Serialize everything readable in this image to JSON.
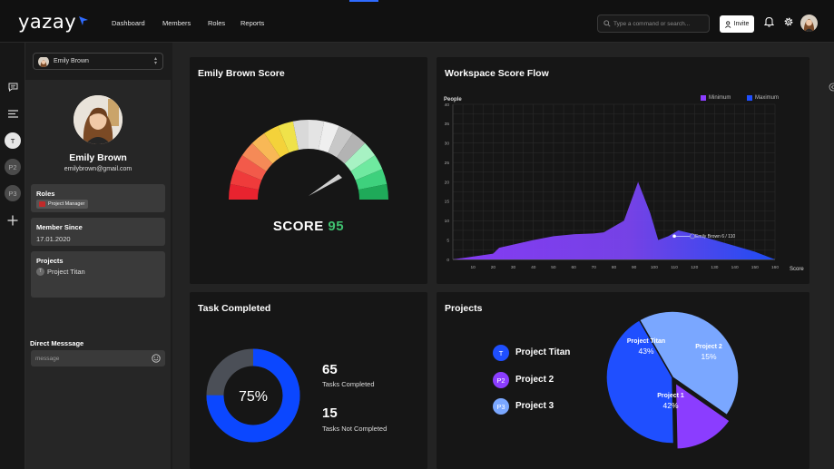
{
  "header": {
    "logo": "yazay",
    "nav": [
      "Dashboard",
      "Members",
      "Roles",
      "Reports"
    ],
    "search_placeholder": "Type a command or search...",
    "invite_label": "Invite"
  },
  "rail": {
    "items": [
      {
        "icon": "chat-icon"
      },
      {
        "icon": "list-icon"
      },
      {
        "label": "T"
      },
      {
        "label": "P2"
      },
      {
        "label": "P3"
      },
      {
        "icon": "plus-icon"
      }
    ]
  },
  "profile": {
    "selected_user": "Emily Brown",
    "name": "Emily Brown",
    "email": "emilybrown@gmail.com",
    "roles_label": "Roles",
    "role": "Project Manager",
    "member_since_label": "Member Since",
    "member_since": "17.01.2020",
    "projects_label": "Projects",
    "project": "Project Titan",
    "project_initial": "T",
    "dm_label": "Direct Messsage",
    "dm_placeholder": "message"
  },
  "score_card": {
    "title": "Emily Brown Score",
    "score_label": "SCORE",
    "score": "95"
  },
  "flow_card": {
    "title": "Workspace Score Flow",
    "y_title": "People",
    "x_title": "Score",
    "legend": [
      {
        "label": "Minimum",
        "color": "#8b3dff"
      },
      {
        "label": "Maximum",
        "color": "#1f4fff"
      }
    ],
    "tooltip": "Emily Brown 6 / 110"
  },
  "chart_data": {
    "type": "area",
    "x_ticks": [
      10,
      20,
      30,
      40,
      50,
      60,
      70,
      80,
      90,
      100,
      110,
      120,
      130,
      140,
      150,
      160
    ],
    "y_ticks": [
      0,
      5,
      10,
      15,
      20,
      25,
      30,
      35,
      40
    ],
    "xlim": [
      0,
      160
    ],
    "ylim": [
      0,
      40
    ],
    "x": [
      0,
      20,
      23,
      40,
      50,
      60,
      70,
      75,
      85,
      92,
      98,
      102,
      107,
      112,
      120,
      130,
      140,
      150,
      160
    ],
    "y": [
      0,
      1.5,
      3,
      5,
      6,
      6.5,
      6.7,
      7,
      10,
      20,
      12,
      5,
      6,
      7.5,
      6.5,
      5,
      3.5,
      2,
      0
    ],
    "grid": true,
    "highlight_point": {
      "x": 110,
      "y": 6
    }
  },
  "tasks_card": {
    "title": "Task Completed",
    "percent_label": "75%",
    "percent": 75,
    "completed": "65",
    "completed_label": "Tasks Completed",
    "not_completed": "15",
    "not_completed_label": "Tasks Not Completed"
  },
  "projects_card": {
    "title": "Projects",
    "items": [
      {
        "badge": "T",
        "name": "Project Titan",
        "color": "#1f4fff"
      },
      {
        "badge": "P2",
        "name": "Project 2",
        "color": "#8b3dff"
      },
      {
        "badge": "P3",
        "name": "Project 3",
        "color": "#7aa7ff"
      }
    ],
    "pie": [
      {
        "name": "Project Titan",
        "pct_label": "43%",
        "value": 43,
        "color": "#7aa7ff"
      },
      {
        "name": "Project 2",
        "pct_label": "15%",
        "value": 15,
        "color": "#8b3dff"
      },
      {
        "name": "Project 1",
        "pct_label": "42%",
        "value": 42,
        "color": "#1f4fff"
      }
    ]
  }
}
